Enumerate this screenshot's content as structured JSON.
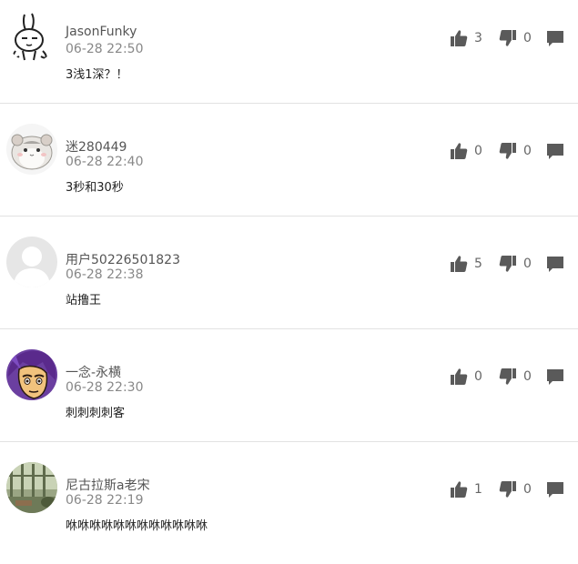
{
  "comments": [
    {
      "username": "JasonFunky",
      "time": "06-28 22:50",
      "content": "3浅1深？！",
      "likes": "3",
      "dislikes": "0",
      "avatar": "rabbit-avatar"
    },
    {
      "username": "迷280449",
      "time": "06-28 22:40",
      "content": "3秒和30秒",
      "likes": "0",
      "dislikes": "0",
      "avatar": "hamster-avatar"
    },
    {
      "username": "用户50226501823",
      "time": "06-28 22:38",
      "content": "站撸王",
      "likes": "5",
      "dislikes": "0",
      "avatar": "default-user-avatar"
    },
    {
      "username": "一念-永横",
      "time": "06-28 22:30",
      "content": "刺刺刺刺客",
      "likes": "0",
      "dislikes": "0",
      "avatar": "purple-hair-avatar"
    },
    {
      "username": "尼古拉斯a老宋",
      "time": "06-28 22:19",
      "content": "咻咻咻咻咻咻咻咻咻咻咻咻",
      "likes": "1",
      "dislikes": "0",
      "avatar": "window-room-avatar"
    }
  ],
  "icons": {
    "like": "thumbs-up-icon",
    "dislike": "thumbs-down-icon",
    "reply": "comment-bubble-icon"
  },
  "colors": {
    "icon": "#5a5a5a",
    "divider": "#e2e2e2",
    "time": "#888888"
  }
}
